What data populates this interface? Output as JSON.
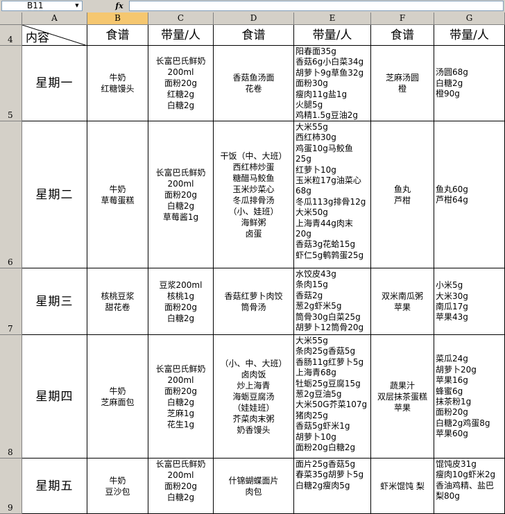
{
  "formula_bar": {
    "name_box": "B11",
    "fx": "fx",
    "formula": ""
  },
  "columns": [
    "A",
    "B",
    "C",
    "D",
    "E",
    "F",
    "G"
  ],
  "selected_column": "B",
  "rows": [
    "4",
    "5",
    "6",
    "7",
    "8",
    "9"
  ],
  "header": {
    "corner_label": "内容",
    "b": "食谱",
    "c": "带量/人",
    "d": "食谱",
    "e": "带量/人",
    "f": "食谱",
    "g": "带量/人"
  },
  "days": [
    {
      "day": "星期一",
      "b": "牛奶\n红糖馒头",
      "c": "长富巴氏鲜奶\n200ml\n面粉20g\n红糖2g\n白糖2g",
      "d": "香菇鱼汤面\n花卷",
      "e": "阳春面35g\n香菇6g小白菜34g\n胡萝卜9g草鱼32g\n面粉30g\n瘦肉11g盐1g\n火腿5g\n鸡精1.5g豆油2g",
      "f": "芝麻汤圆\n橙",
      "g": "汤圆68g\n白糖2g\n橙90g"
    },
    {
      "day": "星期二",
      "b": "牛奶\n草莓蛋糕",
      "c": "长富巴氏鲜奶\n200ml\n面粉20g\n白糖2g\n草莓酱1g",
      "d": "干饭（中、大班）\n西红柿炒蛋\n糖醋马鲛鱼\n玉米炒菜心\n冬瓜排骨汤\n（小、娃班）\n海鲜粥\n卤蛋",
      "e": "大米55g\n西红柿30g\n鸡蛋10g马鲛鱼\n25g\n红萝卜10g\n玉米粒17g油菜心\n68g\n冬瓜113g排骨12g\n大米50g\n上海青44g肉末\n20g\n香菇3g花蛤15g\n虾仁5g鹌鹑蛋25g",
      "f": "鱼丸\n芦柑",
      "g": "鱼丸60g\n芦柑64g"
    },
    {
      "day": "星期三",
      "b": "核桃豆浆\n甜花卷",
      "c": "豆浆200ml\n核桃1g\n面粉20g\n白糖2g",
      "d": "香菇红萝卜肉饺\n筒骨汤",
      "e": "水饺皮43g\n条肉15g\n香菇2g\n葱2g虾米5g\n筒骨30g白菜25g\n胡萝卜12筒骨20g",
      "f": "双米南瓜粥\n苹果",
      "g": "小米5g\n大米30g\n南瓜17g\n苹果43g"
    },
    {
      "day": "星期四",
      "b": "牛奶\n芝麻面包",
      "c": "长富巴氏鲜奶\n200ml\n面粉20g\n白糖2g\n芝麻1g\n花生1g",
      "d": "（小、中、大班）\n卤肉饭\n炒上海青\n海蛎豆腐汤\n（娃娃班）\n芥菜肉末粥\n奶香馒头",
      "e": "大米55g\n条肉25g香菇5g\n香肠11g红萝卜5g\n上海青68g\n牡蛎25g豆腐15g\n葱2g豆油5g\n大米50G芥菜107g\n猪肉25g\n香菇5g虾米1g\n胡萝卜10g\n面粉20g白糖2g",
      "f": "蔬果汁\n双层抹茶蛋糕\n苹果",
      "g": "菜瓜24g\n胡萝卜20g\n苹果16g\n蜂蜜6g\n抹茶粉1g\n面粉20g\n白糖2g鸡蛋8g\n苹果60g"
    },
    {
      "day": "星期五",
      "b": "牛奶\n豆沙包",
      "c": "长富巴氏鲜奶\n200ml\n面粉20g\n白糖2g",
      "d": "什锦蝴蝶面片\n肉包",
      "e": "面片25g香菇5g\n春菜35g胡萝卜5g\n白糖2g瘦肉5g",
      "f": "虾米馄饨 梨",
      "g": "馄饨皮31g\n瘦肉10g虾米2g\n香油鸡精、盐巴\n梨80g"
    }
  ]
}
